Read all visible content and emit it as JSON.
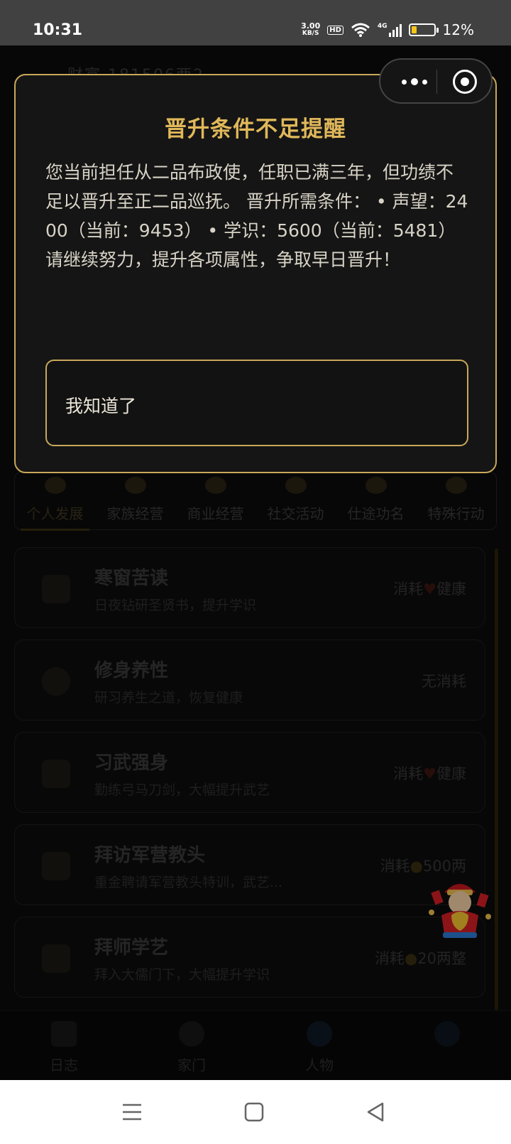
{
  "status_bar": {
    "time": "10:31",
    "net_speed_value": "3.00",
    "net_speed_unit": "KB/S",
    "hd": "HD",
    "network": "4G",
    "battery": "12%",
    "battery_level": 0.12
  },
  "capsule": {
    "more": "more-dots-icon",
    "close": "close-target-icon"
  },
  "background": {
    "header_fragment": "财富 181506两2",
    "tabs": [
      {
        "label": "个人发展",
        "active": true
      },
      {
        "label": "家族经营"
      },
      {
        "label": "商业经营"
      },
      {
        "label": "社交活动"
      },
      {
        "label": "仕途功名"
      },
      {
        "label": "特殊行动"
      }
    ],
    "activities": [
      {
        "title": "寒窗苦读",
        "desc": "日夜钻研圣贤书，提升学识",
        "cost_prefix": "消耗",
        "cost_icon": "heart-icon",
        "cost_value": "健康"
      },
      {
        "title": "修身养性",
        "desc": "研习养生之道，恢复健康",
        "cost_prefix": "无消耗",
        "cost_icon": "",
        "cost_value": ""
      },
      {
        "title": "习武强身",
        "desc": "勤练弓马刀剑，大幅提升武艺",
        "cost_prefix": "消耗",
        "cost_icon": "heart-icon",
        "cost_value": "健康"
      },
      {
        "title": "拜访军营教头",
        "desc": "重金聘请军营教头特训，武艺...",
        "cost_prefix": "消耗",
        "cost_icon": "money-bag-icon",
        "cost_value": "500两"
      },
      {
        "title": "拜师学艺",
        "desc": "拜入大儒门下，大幅提升学识",
        "cost_prefix": "消耗",
        "cost_icon": "money-bag-icon",
        "cost_value": "20两整"
      }
    ],
    "bottom_nav": [
      {
        "label": "日志"
      },
      {
        "label": "家门"
      },
      {
        "label": "人物"
      },
      {
        "label": ""
      }
    ]
  },
  "modal": {
    "title": "晋升条件不足提醒",
    "body": "您当前担任从二品布政使，任职已满三年，但功绩不足以晋升至正二品巡抚。 晋升所需条件： • 声望：2400（当前：9453） • 学识：5600（当前：5481） 请继续努力，提升各项属性，争取早日晋升！",
    "confirm_label": "我知道了"
  },
  "colors": {
    "accent_gold": "#c9a85a",
    "title_gold": "#e0b85a",
    "modal_bg": "#151515",
    "status_bar_bg": "#414141"
  }
}
